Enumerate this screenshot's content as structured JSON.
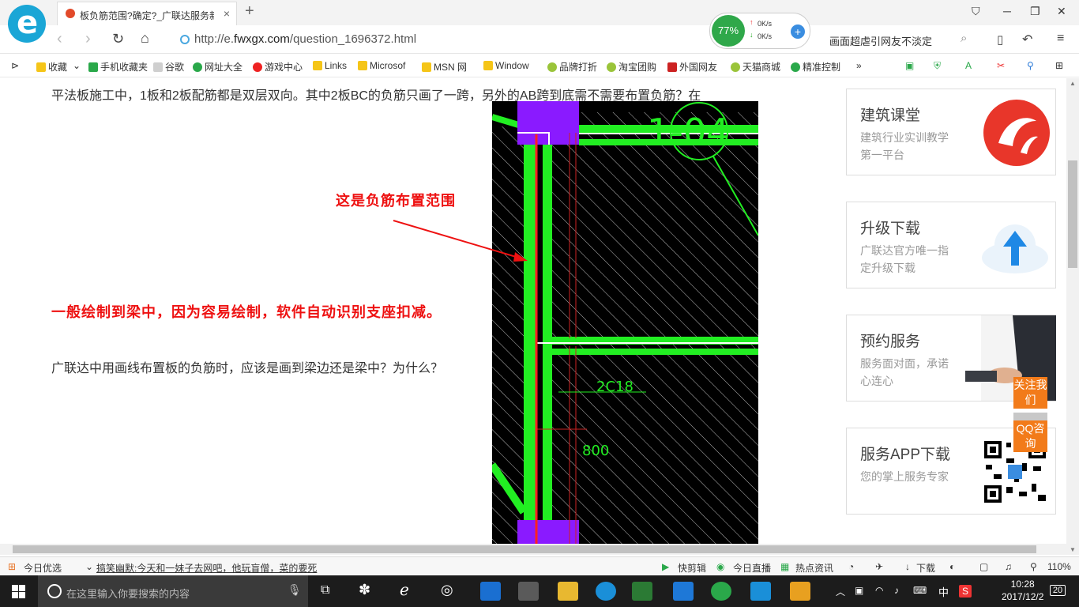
{
  "browser": {
    "tab_title": "板负筋范围?确定?_广联达服务新干线",
    "tab_close": "×",
    "new_tab": "+",
    "url_prefix": "http://e.",
    "url_domain": "fwxgx.com",
    "url_path": "/question_1696372.html",
    "speed_percent": "77%",
    "speed_up": "0K/s",
    "speed_down": "0K/s",
    "search_text": "画面超虐引网友不淡定"
  },
  "bookmarks": [
    {
      "label": "收藏",
      "color": "#f5c518"
    },
    {
      "label": "手机收藏夹",
      "color": "#2aa84a"
    },
    {
      "label": "谷歌",
      "color": "#cfcfcf"
    },
    {
      "label": "网址大全",
      "color": "#2aa84a"
    },
    {
      "label": "游戏中心",
      "color": "#e22"
    },
    {
      "label": "Links",
      "color": "#f5c518"
    },
    {
      "label": "Microsof",
      "color": "#f5c518"
    },
    {
      "label": "MSN 网",
      "color": "#f5c518"
    },
    {
      "label": "Window",
      "color": "#f5c518"
    },
    {
      "label": "品牌打折",
      "color": "#9ac43a"
    },
    {
      "label": "淘宝团购",
      "color": "#9ac43a"
    },
    {
      "label": "外国网友",
      "color": "#c22"
    },
    {
      "label": "天猫商城",
      "color": "#9ac43a"
    },
    {
      "label": "精准控制",
      "color": "#2aa84a"
    }
  ],
  "content": {
    "article_line": "平法板施工中，1板和2板配筋都是双层双向。其中2板BC的负筋只画了一跨，另外的AB跨到底需不需要布置负筋？在",
    "question": "广联达中用画线布置板的负筋时，应该是画到梁边还是梁中？为什么？",
    "annotation_range": "这是负筋布置范围",
    "annotation_answer": "一般绘制到梁中，因为容易绘制，软件自动识别支座扣减。",
    "cad_label_main": "1-04",
    "cad_label_rebar": "2C18",
    "cad_label_len": "800"
  },
  "sidebar": {
    "cards": [
      {
        "title": "建筑课堂",
        "desc": "建筑行业实训教学第一平台"
      },
      {
        "title": "升级下载",
        "desc": "广联达官方唯一指定升级下载"
      },
      {
        "title": "预约服务",
        "desc": "服务面对面，承诺心连心"
      },
      {
        "title": "服务APP下载",
        "desc": "您的掌上服务专家"
      }
    ],
    "follow_label": "关注我们",
    "qq_label": "QQ咨询",
    "totop": "︿"
  },
  "statusbar": {
    "today": "今日优选",
    "news": "搞笑幽默:今天和一妹子去网吧，他玩盲僧，菜的要死",
    "kuaijianji": "快剪辑",
    "live": "今日直播",
    "hot": "热点资讯",
    "download": "下载",
    "zoom": "110%"
  },
  "taskbar": {
    "search_placeholder": "在这里输入你要搜索的内容",
    "ime": "中",
    "time": "10:28",
    "date": "2017/12/2",
    "notifications": "20"
  }
}
